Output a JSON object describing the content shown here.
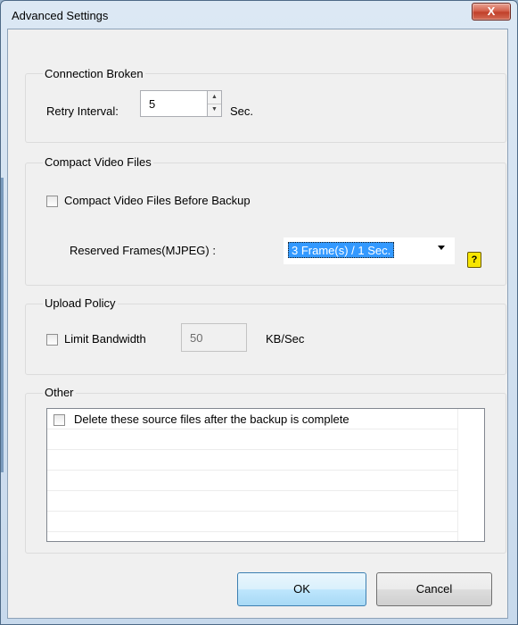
{
  "window": {
    "title": "Advanced Settings",
    "close_label": "X"
  },
  "connection_broken": {
    "legend": "Connection Broken",
    "retry_label": "Retry Interval:",
    "retry_value": "5",
    "unit": "Sec."
  },
  "compact_video": {
    "legend": "Compact Video Files",
    "checkbox_label": "Compact Video Files Before Backup",
    "checked": false,
    "reserved_label": "Reserved Frames(MJPEG) :",
    "reserved_value": "3 Frame(s) / 1 Sec.",
    "help_glyph": "?"
  },
  "upload_policy": {
    "legend": "Upload Policy",
    "checkbox_label": "Limit Bandwidth",
    "checked": false,
    "bandwidth_value": "50",
    "unit": "KB/Sec"
  },
  "other": {
    "legend": "Other",
    "options": [
      {
        "label": "Delete these source files after the backup is complete",
        "checked": false
      }
    ]
  },
  "buttons": {
    "ok": "OK",
    "cancel": "Cancel"
  },
  "icons": {
    "close": "close-icon",
    "spin_up": "chevron-up-icon",
    "spin_down": "chevron-down-icon",
    "dropdown": "dropdown-arrow-icon",
    "help": "help-icon"
  }
}
